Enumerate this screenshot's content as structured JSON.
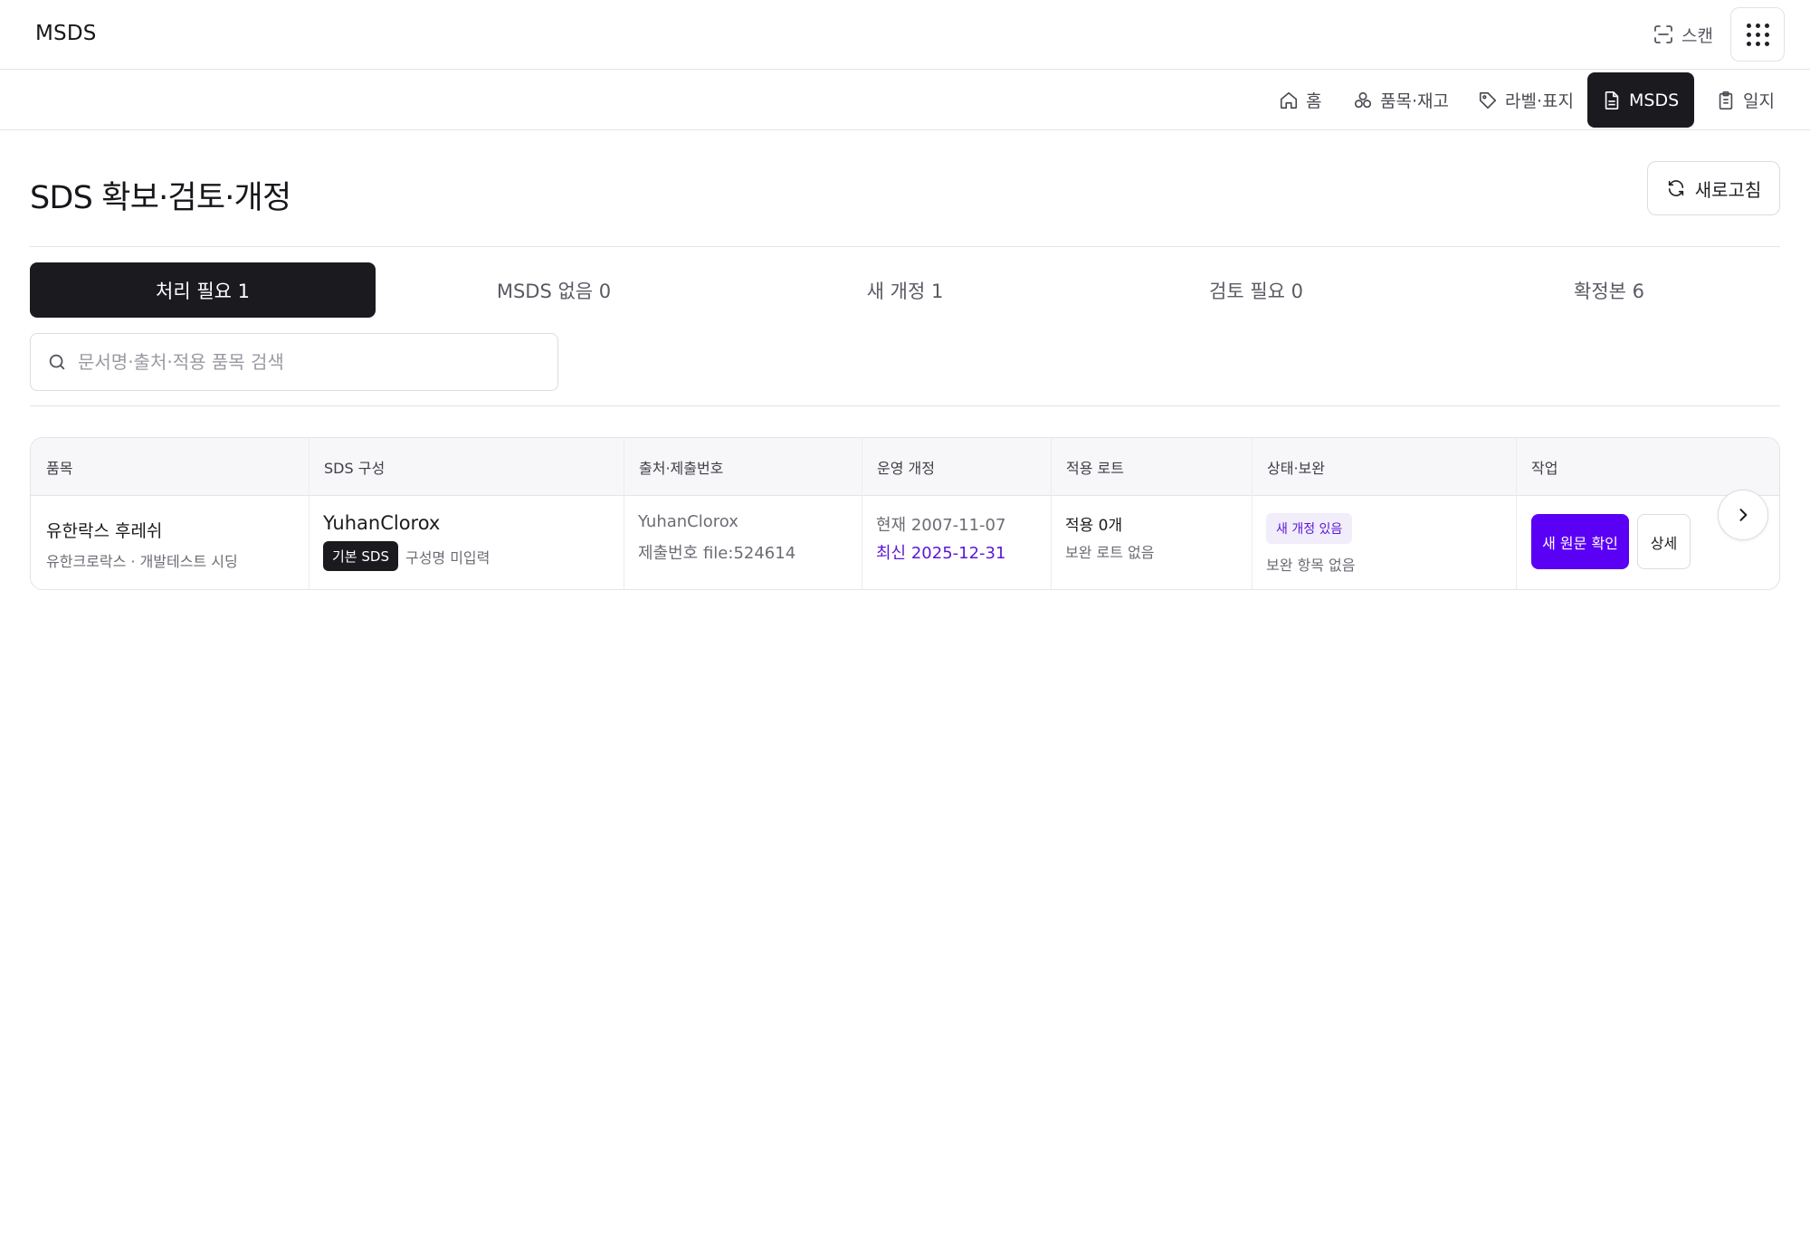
{
  "app": {
    "title": "MSDS",
    "scan_label": "스캔"
  },
  "nav": {
    "items": [
      {
        "label": "홈",
        "icon": "home-icon"
      },
      {
        "label": "품목·재고",
        "icon": "boxes-icon"
      },
      {
        "label": "라벨·표지",
        "icon": "tag-icon"
      },
      {
        "label": "MSDS",
        "icon": "document-icon",
        "active": true
      },
      {
        "label": "일지",
        "icon": "clipboard-icon"
      }
    ]
  },
  "header": {
    "title": "SDS 확보·검토·개정",
    "refresh_label": "새로고침"
  },
  "tabs": [
    {
      "label": "처리 필요 1",
      "active": true
    },
    {
      "label": "MSDS 없음 0"
    },
    {
      "label": "새 개정 1"
    },
    {
      "label": "검토 필요 0"
    },
    {
      "label": "확정본 6"
    }
  ],
  "search": {
    "placeholder": "문서명·출처·적용 품목 검색",
    "value": ""
  },
  "table": {
    "columns": [
      "품목",
      "SDS 구성",
      "출처·제출번호",
      "운영 개정",
      "적용 로트",
      "상태·보완",
      "작업"
    ],
    "rows": [
      {
        "item_name": "유한락스 후레쉬",
        "item_sub": "유한크로락스 · 개발테스트 시딩",
        "sds_name": "YuhanClorox",
        "sds_badge": "기본 SDS",
        "sds_note": "구성명 미입력",
        "source": "YuhanClorox",
        "submission": "제출번호 file:524614",
        "revision_current": "현재 2007-11-07",
        "revision_latest": "최신 2025-12-31",
        "lots_applied": "적용 0개",
        "lots_note": "보완 로트 없음",
        "status_badge": "새 개정 있음",
        "status_note": "보완 항목 없음",
        "action_primary": "새 원문 확인",
        "action_detail": "상세"
      }
    ]
  },
  "colors": {
    "accent": "#5a00f5",
    "active_dark": "#1b1b1f",
    "status_badge_bg": "#f1edfb",
    "status_badge_fg": "#5b16d6"
  }
}
